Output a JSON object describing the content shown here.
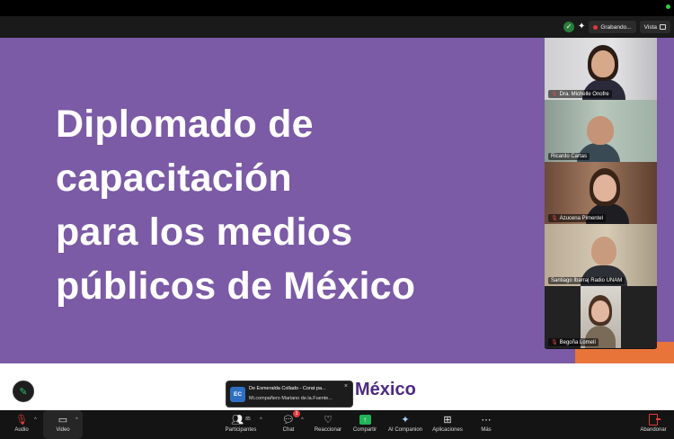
{
  "slide": {
    "title_lines": [
      "Diplomado de",
      "capacitación",
      "para los medios",
      "públicos de México"
    ],
    "logo_text": "México"
  },
  "header": {
    "recording_label": "Grabando...",
    "view_label": "Vista"
  },
  "gallery": {
    "participants": [
      {
        "name": "Dra. Michelle Onofre",
        "muted": true,
        "active": false
      },
      {
        "name": "Ricardo Cartas",
        "muted": false,
        "active": true
      },
      {
        "name": "Azucena Pimentel",
        "muted": true,
        "active": false
      },
      {
        "name": "Santiago Ibarra| Radio UNAM",
        "muted": false,
        "active": false
      },
      {
        "name": "Begoña Lomelí",
        "muted": true,
        "active": false
      }
    ]
  },
  "chat_toast": {
    "avatar_initials": "EC",
    "from": "De Esmeralda Collado - Corat pa...",
    "message": "Mi.compañero Mariano de.la.Fuente...",
    "close_icon": "close-icon"
  },
  "toolbar": {
    "audio_label": "Audio",
    "video_label": "Video",
    "participants_label": "Participantes",
    "participants_count": "85",
    "chat_label": "Chat",
    "chat_badge": "3",
    "react_label": "Reaccionar",
    "share_label": "Compartir",
    "ai_label": "AI Companion",
    "apps_label": "Aplicaciones",
    "more_label": "Más",
    "leave_label": "Abandonar"
  },
  "colors": {
    "slide_purple": "#7b5aa6",
    "slide_orange": "#e8743a",
    "active_speaker": "#2ecc71",
    "share_green": "#22b45a",
    "leave_red": "#e03c3c"
  }
}
